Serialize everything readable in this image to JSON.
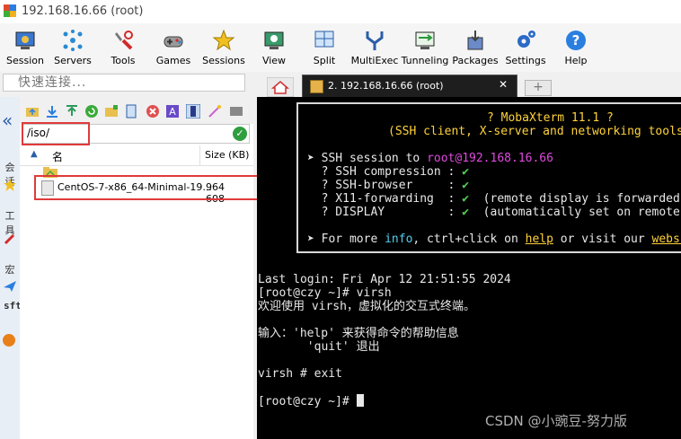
{
  "window": {
    "title": "192.168.16.66 (root)"
  },
  "toolbar": {
    "buttons": [
      {
        "label": "Session",
        "icon": "session-icon"
      },
      {
        "label": "Servers",
        "icon": "servers-icon"
      },
      {
        "label": "Tools",
        "icon": "tools-icon"
      },
      {
        "label": "Games",
        "icon": "games-icon"
      },
      {
        "label": "Sessions",
        "icon": "star-icon"
      },
      {
        "label": "View",
        "icon": "view-icon"
      },
      {
        "label": "Split",
        "icon": "split-icon"
      },
      {
        "label": "MultiExec",
        "icon": "multiexec-icon"
      },
      {
        "label": "Tunneling",
        "icon": "tunneling-icon"
      },
      {
        "label": "Packages",
        "icon": "packages-icon"
      },
      {
        "label": "Settings",
        "icon": "gear-icon"
      },
      {
        "label": "Help",
        "icon": "help-icon"
      }
    ]
  },
  "quick_connect": {
    "placeholder": "快速连接..."
  },
  "tabs": {
    "session_tab_label": "2. 192.168.16.66 (root)",
    "close_label": "✕"
  },
  "sidebar": {
    "labels": [
      "会话",
      "工具",
      "宏",
      "sftp"
    ]
  },
  "file_panel": {
    "path": "/iso/",
    "columns": {
      "name": "名",
      "size": "Size (KB)"
    },
    "files": [
      {
        "name": "CentOS-7-x86_64-Minimal-19...",
        "size": "964 608"
      }
    ]
  },
  "terminal": {
    "banner_title": "? MobaXterm 11.1 ?",
    "banner_sub": "(SSH client, X-server and networking tools)",
    "ssh_session": {
      "prefix": "➤ SSH session to ",
      "user": "root",
      "host": "@192.168.16.66"
    },
    "checks": [
      {
        "label": "  ? SSH compression : ",
        "value": "✔",
        "note": ""
      },
      {
        "label": "  ? SSH-browser     : ",
        "value": "✔",
        "note": ""
      },
      {
        "label": "  ? X11-forwarding  : ",
        "value": "✔",
        "note": "  (remote display is forwarded through SSH)"
      },
      {
        "label": "  ? DISPLAY         : ",
        "value": "✔",
        "note": "  (automatically set on remote server)"
      }
    ],
    "more": {
      "prefix": "➤ For more ",
      "info": "info",
      "mid": ", ctrl+click on ",
      "help": "help",
      "mid2": " or visit our ",
      "web": "website"
    },
    "lines": [
      "Last login: Fri Apr 12 21:51:55 2024",
      "[root@czy ~]# virsh",
      "欢迎使用 virsh，虚拟化的交互式终端。",
      "",
      "输入：'help' 来获得命令的帮助信息",
      "       'quit' 退出",
      "",
      "virsh # exit",
      "",
      "[root@czy ~]# "
    ]
  },
  "watermark": "CSDN @小豌豆-努力版",
  "colors": {
    "terminal_bg": "#000000",
    "highlight": "#e03a3a",
    "accent": "#2a5ea8"
  }
}
